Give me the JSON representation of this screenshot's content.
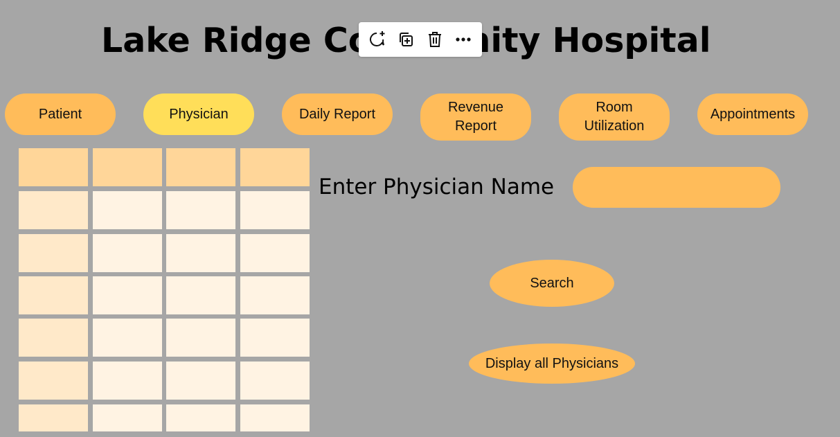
{
  "title": "Lake Ridge Community Hospital",
  "toolbar": {
    "icons": [
      "comment-add-icon",
      "duplicate-icon",
      "trash-icon",
      "more-icon"
    ]
  },
  "nav": [
    {
      "label": "Patient",
      "active": false
    },
    {
      "label": "Physician",
      "active": true
    },
    {
      "label": "Daily Report",
      "active": false
    },
    {
      "label": "Revenue Report",
      "active": false
    },
    {
      "label": "Room Utilization",
      "active": false
    },
    {
      "label": "Appointments",
      "active": false
    }
  ],
  "table": {
    "rows": 7,
    "columns": 4
  },
  "form": {
    "label": "Enter Physician Name",
    "input_value": "",
    "search_label": "Search",
    "display_all_label": "Display all Physicians"
  },
  "colors": {
    "background": "#a6a6a6",
    "button": "#ffbc5a",
    "active_button": "#ffde59",
    "header_cell": "#ffd699",
    "first_col_cell": "#ffe9c9",
    "body_cell": "#fff3e3"
  }
}
